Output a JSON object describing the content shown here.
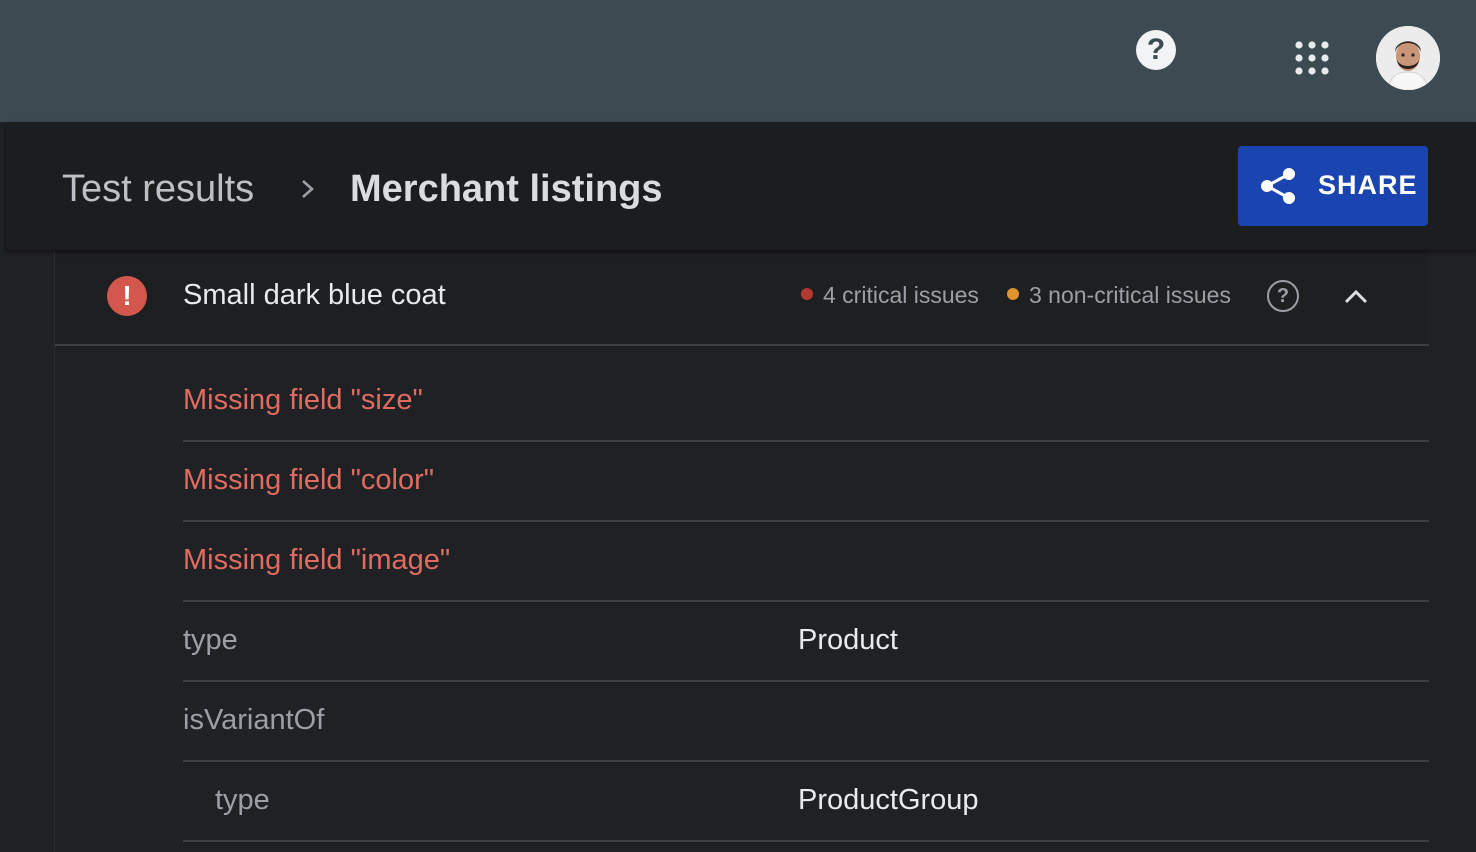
{
  "topbar": {
    "help_glyph": "?",
    "help_icon": "help-circle-icon",
    "apps_icon": "apps-grid-icon",
    "avatar_icon": "user-avatar"
  },
  "breadcrumb": {
    "parent": "Test results",
    "separator_icon": "chevron-right-icon",
    "current": "Merchant listings"
  },
  "share": {
    "label": "SHARE",
    "icon": "share-icon",
    "color": "#1a44b0"
  },
  "item": {
    "title": "Small dark blue coat",
    "status_icon": "error-icon",
    "status_glyph": "!",
    "critical_label": "4 critical issues",
    "critical_color": "#b3382f",
    "noncritical_label": "3 non-critical issues",
    "noncritical_color": "#e0922f",
    "help_glyph": "?",
    "collapse_icon": "chevron-up-icon"
  },
  "errors": [
    "Missing field \"size\"",
    "Missing field \"color\"",
    "Missing field \"image\""
  ],
  "properties": [
    {
      "key": "type",
      "value": "Product"
    },
    {
      "key": "isVariantOf",
      "value": ""
    },
    {
      "key": "type",
      "value": "ProductGroup"
    }
  ],
  "colors": {
    "error_text": "#e06b61",
    "topbar": "#3c4a52",
    "background": "#202124"
  }
}
